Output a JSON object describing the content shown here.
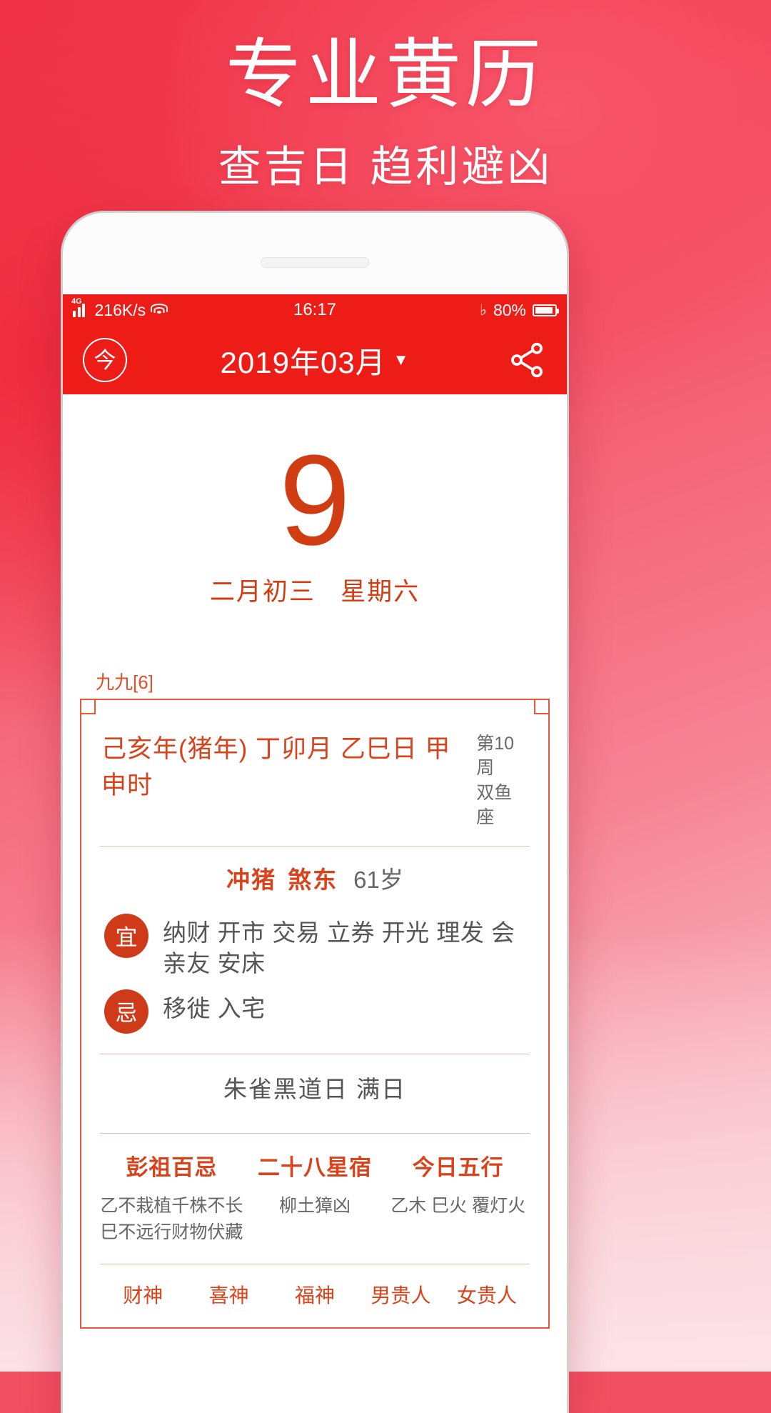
{
  "promo": {
    "title": "专业黄历",
    "subtitle": "查吉日 趋利避凶"
  },
  "statusbar": {
    "network_type": "4G",
    "net_speed": "216K/s",
    "wifi_icon": "wifi-icon",
    "time": "16:17",
    "mute_icon": "mute-icon",
    "battery_percent": "80%",
    "battery_level": 80
  },
  "appbar": {
    "today_button": "今",
    "title": "2019年03月",
    "caret": "▼",
    "share_icon": "share-icon"
  },
  "day": {
    "number": "9",
    "lunar": "二月初三",
    "weekday": "星期六"
  },
  "card": {
    "jiujiu_label": "九九[6]",
    "ganzhi": "己亥年(猪年)  丁卯月  乙巳日  甲申时",
    "week_of_year": "第10周",
    "zodiac_sign": "双鱼座",
    "chong": "冲猪",
    "sha": "煞东",
    "age": "61岁",
    "yi_badge": "宜",
    "yi_text": "纳财 开市 交易 立券 开光 理发 会亲友 安床",
    "ji_badge": "忌",
    "ji_text": "移徙 入宅",
    "shen_line": "朱雀黑道日   满日",
    "columns": [
      {
        "head": "彭祖百忌",
        "body": "乙不栽植千株不长\n巳不远行财物伏藏"
      },
      {
        "head": "二十八星宿",
        "body": "柳土獐凶"
      },
      {
        "head": "今日五行",
        "body": "乙木 巳火 覆灯火"
      }
    ],
    "deities": [
      "财神",
      "喜神",
      "福神",
      "男贵人",
      "女贵人"
    ]
  },
  "colors": {
    "brand_red": "#ee1c16",
    "accent_orange": "#d8431c",
    "card_border": "#e8573a",
    "promo_pink": "#f4566a"
  }
}
